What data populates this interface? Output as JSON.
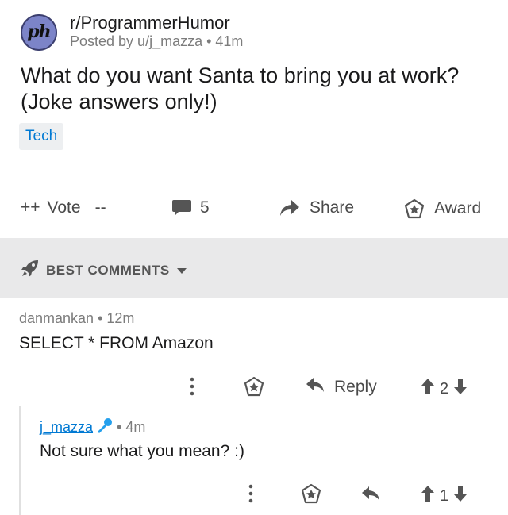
{
  "post": {
    "subreddit_icon_text": "ph",
    "subreddit": "r/ProgrammerHumor",
    "meta": "Posted by u/j_mazza • 41m",
    "title": "What do you want Santa to bring you at work? (Joke answers only!)",
    "flair": "Tech"
  },
  "actions": {
    "upvote": "++",
    "vote_label": "Vote",
    "downvote": "--",
    "comment_count": "5",
    "share_label": "Share",
    "award_label": "Award"
  },
  "sort": {
    "label": "BEST COMMENTS"
  },
  "comments": [
    {
      "author": "danmankan",
      "age": "• 12m",
      "body": "SELECT * FROM Amazon",
      "reply_label": "Reply",
      "score": "2"
    },
    {
      "author": "j_mazza",
      "age": "• 4m",
      "body": "Not sure what you mean? :)",
      "score": "1"
    }
  ],
  "colors": {
    "link_blue": "#0079d3",
    "flair_bg": "#edeff1",
    "band_bg": "#e9e9ea",
    "op_mic": "#24a0ed"
  }
}
